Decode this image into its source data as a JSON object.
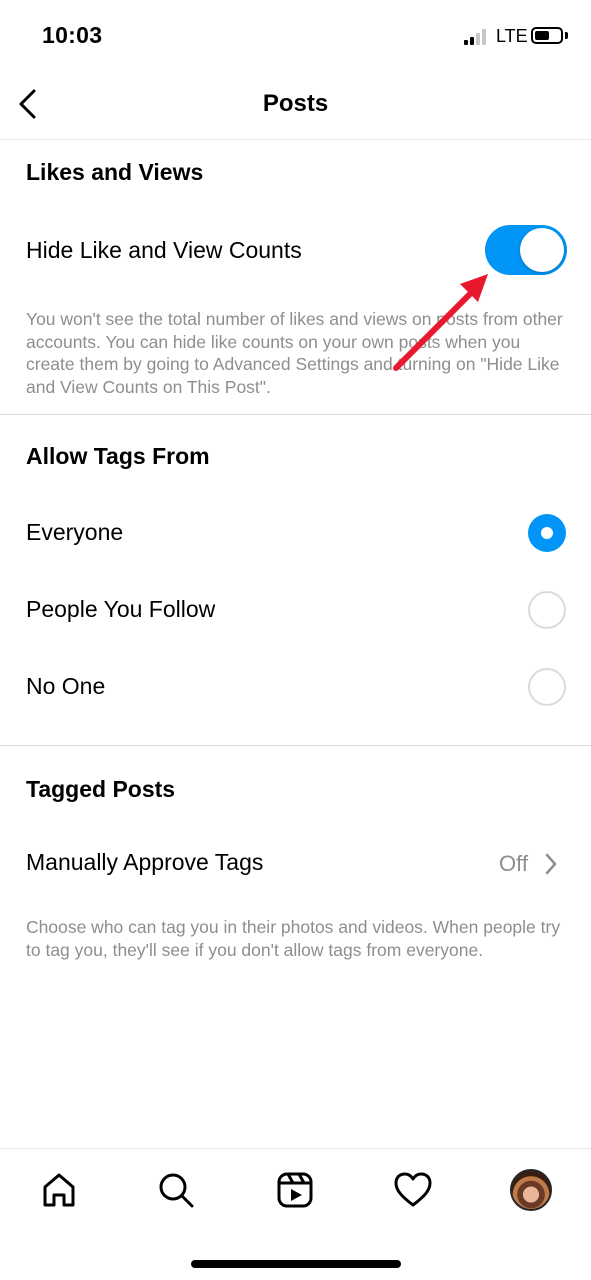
{
  "status_bar": {
    "time": "10:03",
    "network": "LTE"
  },
  "nav": {
    "title": "Posts"
  },
  "likes_section": {
    "heading": "Likes and Views",
    "toggle_label": "Hide Like and View Counts",
    "toggle_on": true,
    "description": "You won't see the total number of likes and views on posts from other accounts. You can hide like counts on your own posts when you create them by going to Advanced Settings and turning on \"Hide Like and View Counts on This Post\"."
  },
  "tags_section": {
    "heading": "Allow Tags From",
    "options": [
      {
        "label": "Everyone",
        "selected": true
      },
      {
        "label": "People You Follow",
        "selected": false
      },
      {
        "label": "No One",
        "selected": false
      }
    ]
  },
  "tagged_section": {
    "heading": "Tagged Posts",
    "row_label": "Manually Approve Tags",
    "row_value": "Off",
    "description": "Choose who can tag you in their photos and videos. When people try to tag you, they'll see if you don't allow tags from everyone."
  },
  "tab_bar": {
    "icons": [
      "home-icon",
      "search-icon",
      "reels-icon",
      "heart-icon",
      "profile-avatar"
    ]
  },
  "colors": {
    "accent": "#0095f6",
    "secondary_text": "#8e8e8e",
    "annotation_arrow": "#e8192c"
  }
}
